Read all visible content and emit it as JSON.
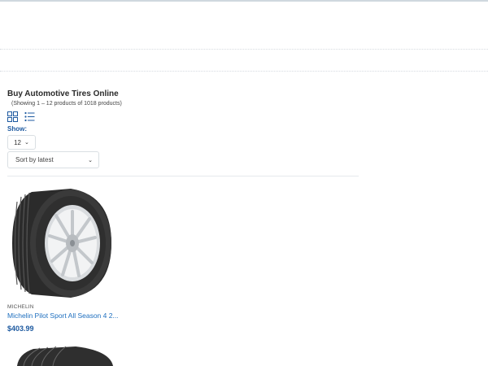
{
  "page": {
    "title": "Buy Automotive Tires Online",
    "results_count": "(Showing 1 – 12 products of 1018 products)"
  },
  "view_toggle": {
    "grid_icon": "grid-view-icon",
    "list_icon": "list-view-icon"
  },
  "show": {
    "label": "Show:",
    "per_page": "12"
  },
  "sort": {
    "selected": "Sort by latest"
  },
  "products": [
    {
      "brand": "MICHELIN",
      "name": "Michelin Pilot Sport All Season 4 2...",
      "price": "$403.99"
    }
  ],
  "colors": {
    "accent": "#1e5aa0",
    "link": "#1e6fbf"
  }
}
